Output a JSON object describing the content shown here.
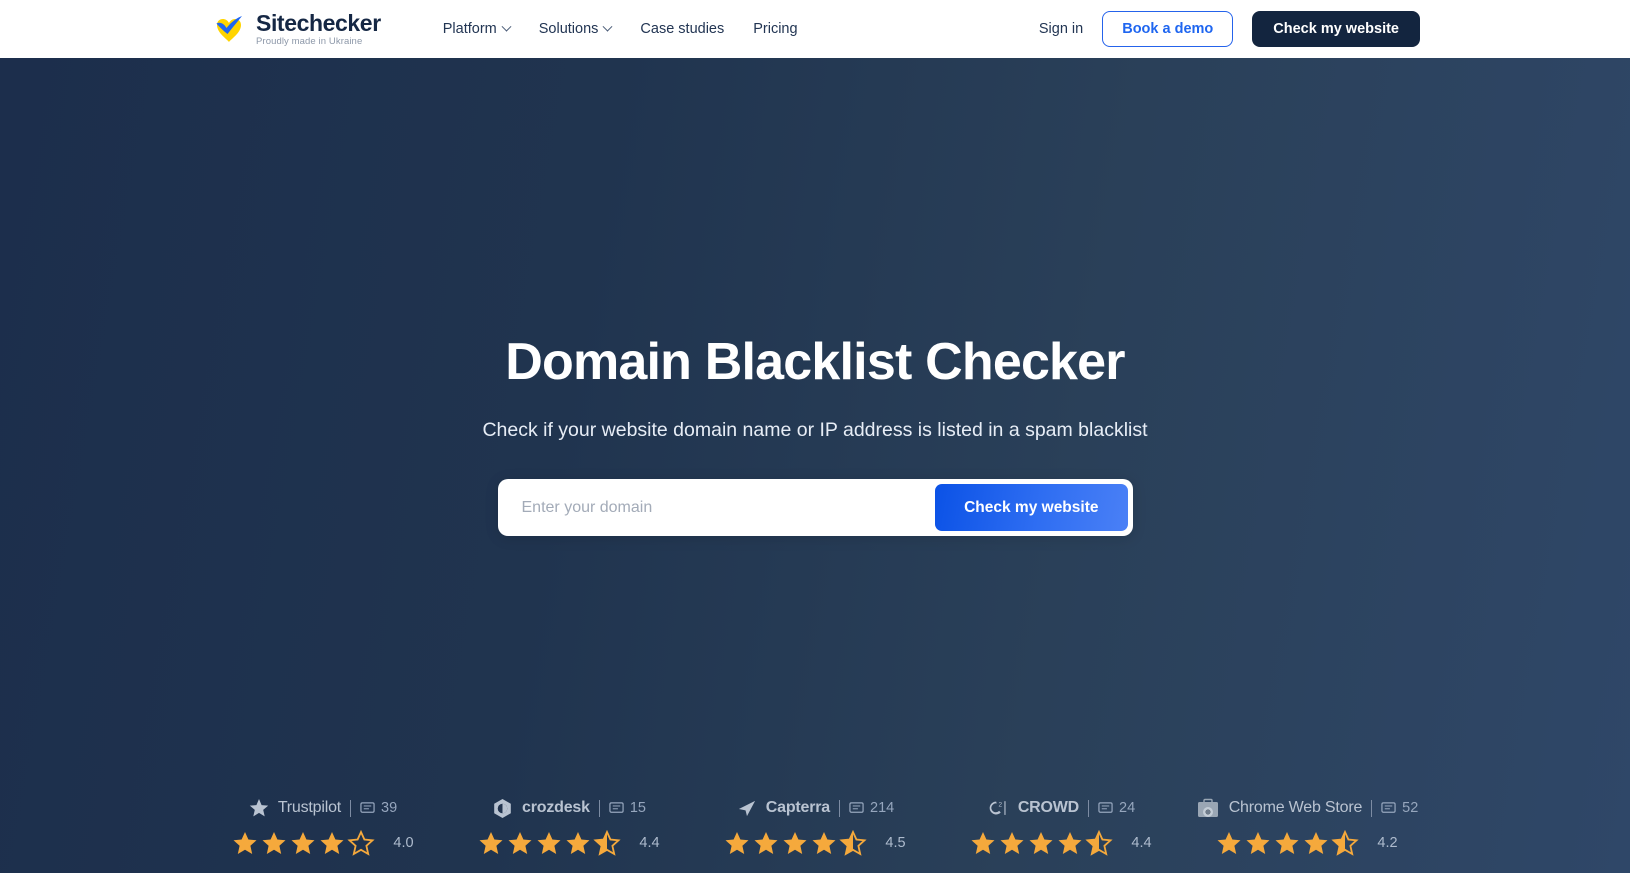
{
  "header": {
    "logo": {
      "name": "Sitechecker",
      "tagline": "Proudly made in Ukraine",
      "icon": "checkmark-heart-logo-icon"
    },
    "nav": [
      {
        "label": "Platform",
        "has_dropdown": true,
        "name": "nav-item-platform"
      },
      {
        "label": "Solutions",
        "has_dropdown": true,
        "name": "nav-item-solutions"
      },
      {
        "label": "Case studies",
        "has_dropdown": false,
        "name": "nav-item-case-studies"
      },
      {
        "label": "Pricing",
        "has_dropdown": false,
        "name": "nav-item-pricing"
      }
    ],
    "sign_in": "Sign in",
    "book_demo": "Book a demo",
    "check_website": "Check my website"
  },
  "hero": {
    "title": "Domain Blacklist Checker",
    "subtitle": "Check if your website domain name or IP address is listed in a spam blacklist",
    "search": {
      "placeholder": "Enter your domain",
      "value": "",
      "button_label": "Check my website"
    }
  },
  "badges": [
    {
      "name": "Trustpilot",
      "icon": "trustpilot-star-icon",
      "reviews": "39",
      "review_icon": "comment-icon",
      "score": "4.0",
      "full_stars": 4,
      "half_star": false,
      "empty_stars": 1
    },
    {
      "name": "crozdesk",
      "icon": "crozdesk-icon",
      "reviews": "15",
      "review_icon": "comment-icon",
      "score": "4.4",
      "full_stars": 4,
      "half_star": true,
      "empty_stars": 0
    },
    {
      "name": "Capterra",
      "icon": "capterra-icon",
      "reviews": "214",
      "review_icon": "comment-icon",
      "score": "4.5",
      "full_stars": 4,
      "half_star": true,
      "empty_stars": 0
    },
    {
      "name": "CROWD",
      "icon": "g2-crowd-icon",
      "reviews": "24",
      "review_icon": "comment-icon",
      "score": "4.4",
      "full_stars": 4,
      "half_star": true,
      "empty_stars": 0
    },
    {
      "name": "Chrome Web Store",
      "icon": "chrome-web-store-icon",
      "reviews": "52",
      "review_icon": "comment-icon",
      "score": "4.2",
      "full_stars": 4,
      "half_star": true,
      "empty_stars": 0
    }
  ],
  "colors": {
    "hero_bg_start": "#1c2e4c",
    "hero_bg_end": "#2f4768",
    "accent_blue": "#1f66f0",
    "cta_dark": "#13253f",
    "star_gold": "#f5a93c",
    "text_light": "#e7edf6"
  }
}
